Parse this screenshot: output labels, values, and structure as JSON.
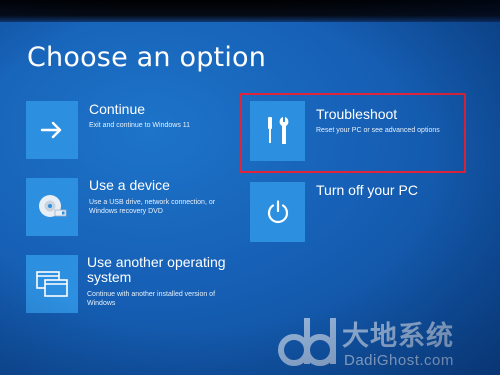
{
  "page": {
    "title": "Choose an option"
  },
  "options": [
    {
      "id": "continue",
      "icon": "arrow-right-icon",
      "label": "Continue",
      "description": "Exit and continue to Windows 11"
    },
    {
      "id": "use-a-device",
      "icon": "disc-drive-icon",
      "label": "Use a device",
      "description": "Use a USB drive, network connection, or Windows recovery DVD"
    },
    {
      "id": "use-another-os",
      "icon": "windows-os-icon",
      "label": "Use another operating system",
      "description": "Continue with another installed version of Windows"
    },
    {
      "id": "troubleshoot",
      "icon": "tools-icon",
      "label": "Troubleshoot",
      "description": "Reset your PC or see advanced options",
      "highlighted": true
    },
    {
      "id": "turn-off",
      "icon": "power-icon",
      "label": "Turn off your PC",
      "description": ""
    }
  ],
  "watermark": {
    "brand_cn": "大地系统",
    "url": "DadiGhost.com"
  },
  "colors": {
    "background": "#1660b6",
    "tile": "#2d8fdf",
    "highlight_border": "#e0243a",
    "text": "#ffffff"
  }
}
